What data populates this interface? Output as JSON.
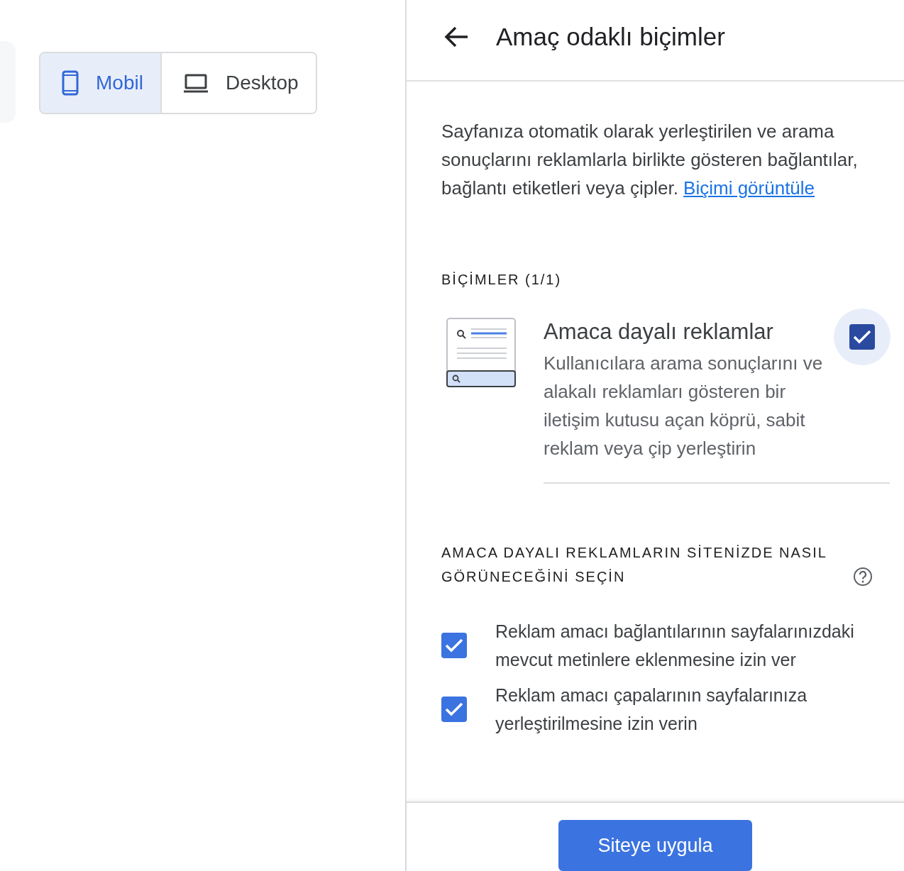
{
  "device_toggle": [
    {
      "label": "Mobil",
      "kind": "mobile",
      "selected": true
    },
    {
      "label": "Desktop",
      "kind": "desktop",
      "selected": false
    }
  ],
  "panel": {
    "title": "Amaç odaklı biçimler",
    "description": {
      "text": "Sayfanıza otomatik olarak yerleştirilen ve arama sonuçlarını reklamlarla birlikte gösteren bağlantılar, bağlantı etiketleri veya çipler.",
      "link": "Biçimi görüntüle"
    },
    "formats_heading": "BİÇİMLER (1/1)",
    "formats": [
      {
        "title": "Amaca dayalı reklamlar",
        "description": "Kullanıcılara arama sonuçlarını ve alakalı reklamları gösteren bir iletişim kutusu açan köprü, sabit reklam veya çip yerleştirin",
        "checked": true
      }
    ],
    "options_heading": "AMACA DAYALI REKLAMLARIN SİTENİZDE NASIL GÖRÜNECEĞİNİ SEÇİN",
    "options": [
      {
        "label": "Reklam amacı bağlantılarının sayfalarınızdaki mevcut metinlere eklenmesine izin ver",
        "checked": true
      },
      {
        "label": "Reklam amacı çapalarının sayfalarınıza yerleştirilmesine izin verin",
        "checked": true
      }
    ],
    "apply_button": "Siteye uygula"
  }
}
